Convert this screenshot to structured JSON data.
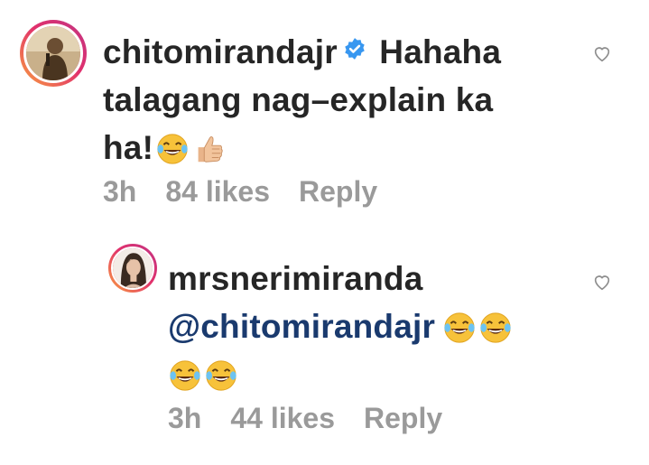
{
  "comments": [
    {
      "username": "chitomirandajr",
      "verified": true,
      "text_line1": "Hahaha",
      "text_line2": "talagang nag–explain ka",
      "text_line3": "ha!",
      "time": "3h",
      "likes": "84 likes",
      "reply_label": "Reply",
      "avatar_icon": "avatar-photo-man-with-microphone",
      "heart_icon": "heart-outline-icon"
    },
    {
      "username": "mrsnerimiranda",
      "verified": false,
      "mention": "@chitomirandajr",
      "time": "3h",
      "likes": "44 likes",
      "reply_label": "Reply",
      "avatar_icon": "avatar-photo-woman",
      "heart_icon": "heart-outline-icon"
    }
  ],
  "colors": {
    "username": "#262626",
    "mention": "#1a3a6e",
    "meta": "#9a9a9a",
    "verified_badge": "#3897f0"
  }
}
